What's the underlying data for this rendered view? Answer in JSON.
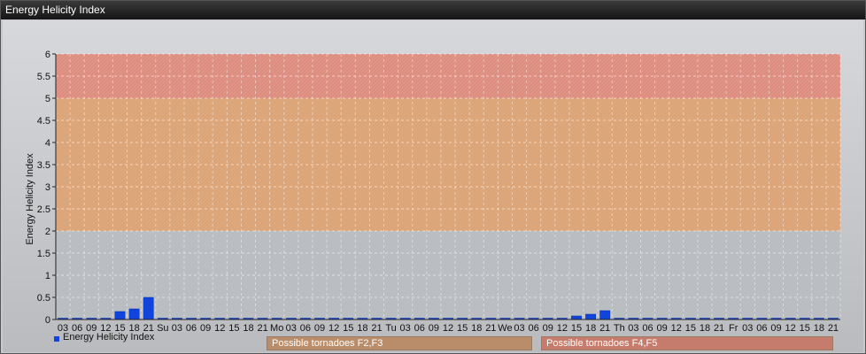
{
  "window": {
    "title": "Energy Helicity Index"
  },
  "chart_data": {
    "type": "bar",
    "title": "",
    "ylabel": "Energy Helicity Index",
    "xlabel": "",
    "ylim": [
      0,
      6
    ],
    "y_ticks": [
      "0",
      "0.5",
      "1",
      "1.5",
      "2",
      "2.5",
      "3",
      "3.5",
      "4",
      "4.5",
      "5",
      "5.5",
      "6"
    ],
    "categories": [
      "03",
      "06",
      "09",
      "12",
      "15",
      "18",
      "21",
      "Su",
      "03",
      "06",
      "09",
      "12",
      "15",
      "18",
      "21",
      "Mo",
      "03",
      "06",
      "09",
      "12",
      "15",
      "18",
      "21",
      "Tu",
      "03",
      "06",
      "09",
      "12",
      "15",
      "18",
      "21",
      "We",
      "03",
      "06",
      "09",
      "12",
      "15",
      "18",
      "21",
      "Th",
      "03",
      "06",
      "09",
      "12",
      "15",
      "18",
      "21",
      "Fr",
      "03",
      "06",
      "09",
      "12",
      "15",
      "18",
      "21"
    ],
    "series": [
      {
        "name": "Energy Helicity Index",
        "color": "#1144dd",
        "values": [
          0,
          0,
          0,
          0,
          0.18,
          0.24,
          0.5,
          0,
          0,
          0,
          0,
          0,
          0,
          0,
          0,
          0,
          0,
          0,
          0,
          0,
          0,
          0,
          0,
          0,
          0,
          0,
          0,
          0,
          0,
          0,
          0,
          0,
          0,
          0,
          0,
          0,
          0.08,
          0.12,
          0.2,
          0,
          0,
          0,
          0,
          0,
          0,
          0,
          0,
          0,
          0,
          0,
          0,
          0,
          0,
          0,
          0
        ]
      }
    ],
    "bands": [
      {
        "from": 2,
        "to": 5,
        "label": "Possible tornadoes F2,F3",
        "color": "#e0a06a"
      },
      {
        "from": 5,
        "to": 6,
        "label": "Possible tornadoes F4,F5",
        "color": "#e38573"
      }
    ],
    "grid": true,
    "legend_position": "bottom-left"
  }
}
